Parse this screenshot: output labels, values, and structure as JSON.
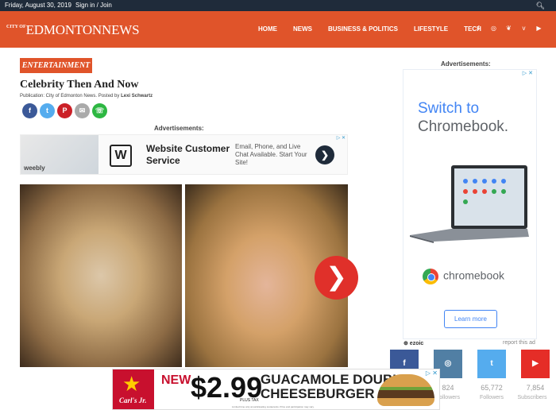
{
  "topbar": {
    "date": "Friday, August 30, 2019",
    "signin": "Sign in / Join",
    "search_icon": "search-icon"
  },
  "header": {
    "logo_city_of": "CITY OF",
    "logo_name": "EDMONTONNEWS",
    "nav": [
      "HOME",
      "NEWS",
      "BUSINESS & POLITICS",
      "LIFESTYLE",
      "TECH"
    ],
    "social": [
      {
        "icon": "facebook-icon",
        "glyph": "f"
      },
      {
        "icon": "instagram-icon",
        "glyph": "◎"
      },
      {
        "icon": "twitter-icon",
        "glyph": "🐦"
      },
      {
        "icon": "vimeo-icon",
        "glyph": "v"
      },
      {
        "icon": "youtube-icon",
        "glyph": "▶"
      }
    ],
    "brand_color": "#e0542a"
  },
  "article": {
    "category": "ENTERTAINMENT",
    "title": "Celebrity Then And Now",
    "byline_prefix": "Publication: City of Edmonton News. Posted by ",
    "author": "Lexi Schwartz",
    "share": [
      {
        "icon": "facebook-icon",
        "glyph": "f",
        "color": "#3b5998"
      },
      {
        "icon": "twitter-icon",
        "glyph": "t",
        "color": "#55acee"
      },
      {
        "icon": "pinterest-icon",
        "glyph": "P",
        "color": "#cb2027"
      },
      {
        "icon": "email-icon",
        "glyph": "✉",
        "color": "#aaaaaa"
      },
      {
        "icon": "whatsapp-icon",
        "glyph": "☏",
        "color": "#2db742"
      }
    ],
    "ads_label": "Advertisements:",
    "next_glyph": "❯"
  },
  "ad_top": {
    "weebly": "weebly",
    "logo": "W",
    "headline": "Website Customer Service",
    "body": "Email, Phone, and Live Chat Available. Start Your Site!",
    "arrow": "❯",
    "adchoice": "▷ ✕"
  },
  "sidebar": {
    "ads_label": "Advertisements:",
    "switch_line1": "Switch to",
    "switch_line2": "Chromebook.",
    "brand": "chromebook",
    "learn_more": "Learn more",
    "adchoice": "▷ ✕",
    "ezoic": "⊕ ezoic",
    "report": "report this ad",
    "follow": [
      {
        "icon": "facebook-icon",
        "glyph": "f",
        "color": "#3b5998",
        "count": "",
        "label": ""
      },
      {
        "icon": "instagram-icon",
        "glyph": "◎",
        "color": "#517fa4",
        "count": "824",
        "label": "Followers"
      },
      {
        "icon": "twitter-icon",
        "glyph": "t",
        "color": "#55acee",
        "count": "65,772",
        "label": "Followers"
      },
      {
        "icon": "youtube-icon",
        "glyph": "▶",
        "color": "#e52d27",
        "count": "7,854",
        "label": "Subscribers"
      }
    ]
  },
  "bottom_ad": {
    "brand": "Carl's Jr.",
    "new": "NEW",
    "price": "$2.99",
    "each": "PLUS TAX",
    "headline1": "GUACAMOLE DOUBLE",
    "headline2": "CHEESEBURGER",
    "fine": "Limited time only at participating restaurants. Price and participation may vary.",
    "close": "▷ ✕"
  }
}
